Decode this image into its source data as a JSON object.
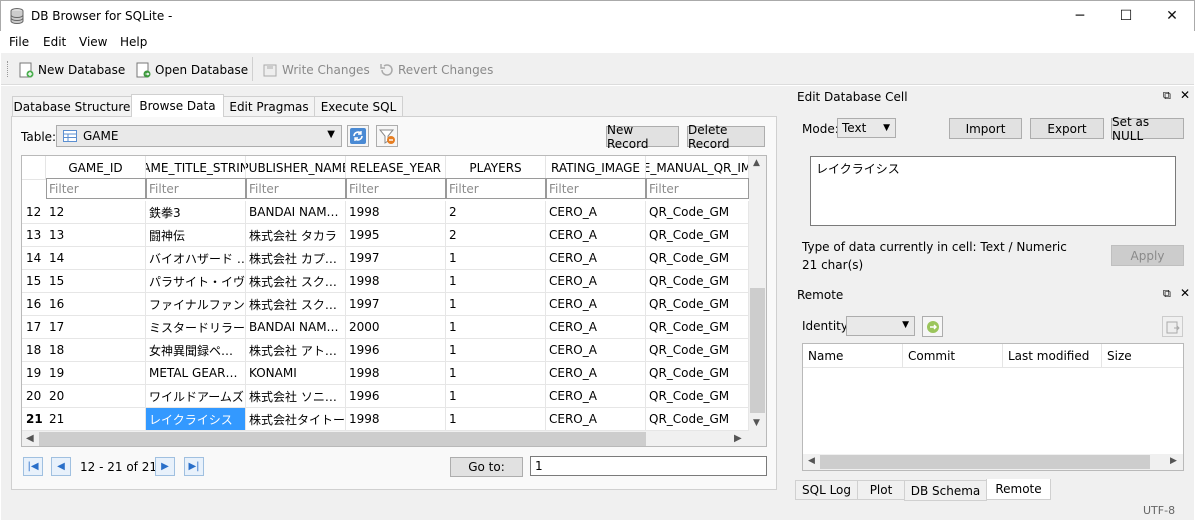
{
  "window": {
    "title": "DB Browser for SQLite -",
    "minimize": "─",
    "maximize": "☐",
    "close": "✕"
  },
  "menu": [
    "File",
    "Edit",
    "View",
    "Help"
  ],
  "toolbar": {
    "new_db": "New Database",
    "open_db": "Open Database",
    "write": "Write Changes",
    "revert": "Revert Changes"
  },
  "tabs": [
    "Database Structure",
    "Browse Data",
    "Edit Pragmas",
    "Execute SQL"
  ],
  "browse": {
    "table_label": "Table:",
    "table_value": "GAME",
    "new_record": "New Record",
    "delete_record": "Delete Record",
    "columns": [
      "GAME_ID",
      "AME_TITLE_STRIN",
      "PUBLISHER_NAME",
      "RELEASE_YEAR",
      "PLAYERS",
      "RATING_IMAGE",
      "E_MANUAL_QR_IM"
    ],
    "filter_placeholder": "Filter",
    "rows": [
      {
        "no": "12",
        "cells": [
          "12",
          "鉄拳3",
          "BANDAI NAM…",
          "1998",
          "2",
          "CERO_A",
          "QR_Code_GM"
        ]
      },
      {
        "no": "13",
        "cells": [
          "13",
          "闘神伝",
          "株式会社 タカラ",
          "1995",
          "2",
          "CERO_A",
          "QR_Code_GM"
        ]
      },
      {
        "no": "14",
        "cells": [
          "14",
          "バイオハザード …",
          "株式会社 カプ…",
          "1997",
          "1",
          "CERO_A",
          "QR_Code_GM"
        ]
      },
      {
        "no": "15",
        "cells": [
          "15",
          "パラサイト・イヴ",
          "株式会社 スク…",
          "1998",
          "1",
          "CERO_A",
          "QR_Code_GM"
        ]
      },
      {
        "no": "16",
        "cells": [
          "16",
          "ファイナルファン…",
          "株式会社 スク…",
          "1997",
          "1",
          "CERO_A",
          "QR_Code_GM"
        ]
      },
      {
        "no": "17",
        "cells": [
          "17",
          "ミスタードリラー",
          "BANDAI NAM…",
          "2000",
          "1",
          "CERO_A",
          "QR_Code_GM"
        ]
      },
      {
        "no": "18",
        "cells": [
          "18",
          "女神異聞録ペ…",
          "株式会社 アト…",
          "1996",
          "1",
          "CERO_A",
          "QR_Code_GM"
        ]
      },
      {
        "no": "19",
        "cells": [
          "19",
          "METAL GEAR…",
          "KONAMI",
          "1998",
          "1",
          "CERO_A",
          "QR_Code_GM"
        ]
      },
      {
        "no": "20",
        "cells": [
          "20",
          "ワイルドアームズ",
          "株式会社 ソニ…",
          "1996",
          "1",
          "CERO_A",
          "QR_Code_GM"
        ]
      },
      {
        "no": "21",
        "cells": [
          "21",
          "レイクライシス",
          "株式会社タイトー",
          "1998",
          "1",
          "CERO_A",
          "QR_Code_GM"
        ]
      }
    ],
    "record_range": "12 - 21 of 21",
    "goto_label": "Go to:",
    "goto_value": "1"
  },
  "edit_cell": {
    "title": "Edit Database Cell",
    "mode_label": "Mode:",
    "mode_value": "Text",
    "import": "Import",
    "export": "Export",
    "set_null": "Set as NULL",
    "content": "レイクライシス",
    "type_info": "Type of data currently in cell: Text / Numeric",
    "size_info": "21 char(s)",
    "apply": "Apply"
  },
  "remote": {
    "title": "Remote",
    "identity_label": "Identity",
    "columns": [
      "Name",
      "Commit",
      "Last modified",
      "Size"
    ]
  },
  "bottom_tabs": [
    "SQL Log",
    "Plot",
    "DB Schema",
    "Remote"
  ],
  "status": {
    "encoding": "UTF-8"
  }
}
